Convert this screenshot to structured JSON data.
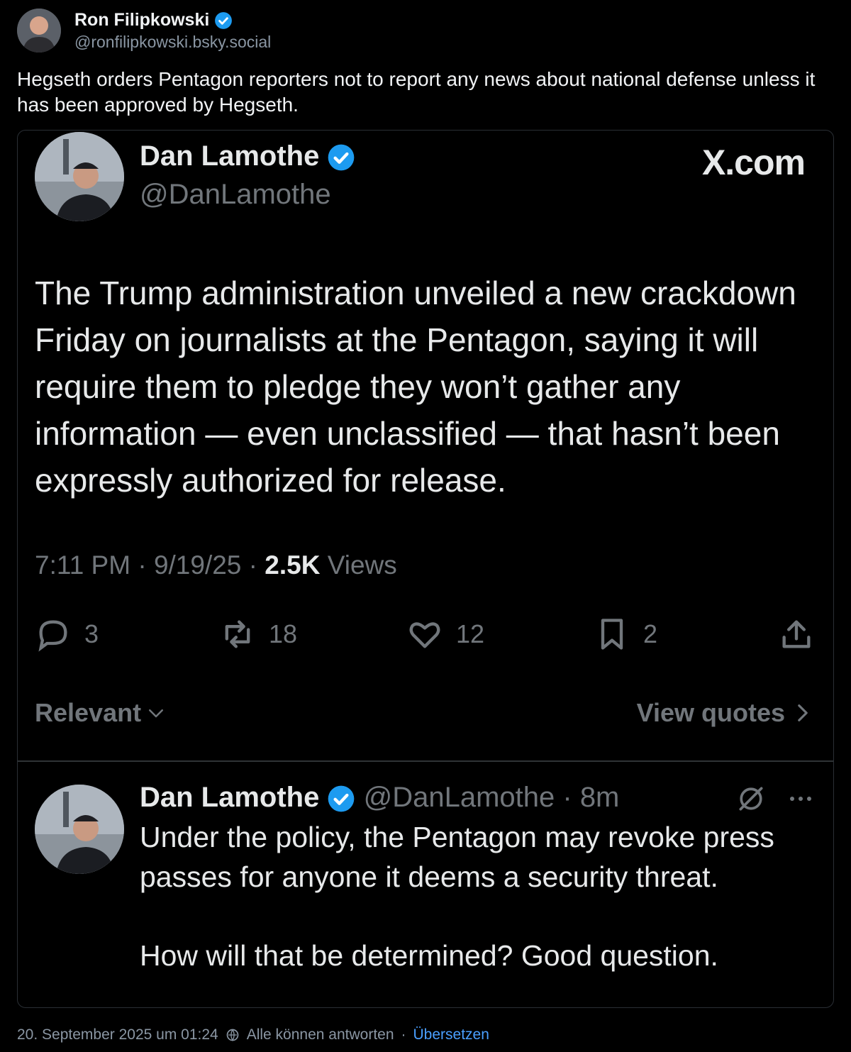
{
  "post": {
    "author": {
      "name": "Ron Filipkowski",
      "handle": "@ronfilipkowski.bsky.social"
    },
    "text": "Hegseth orders Pentagon reporters not to report any news about national defense unless it has been approved by Hegseth.",
    "verified_color": "#1d9bf0"
  },
  "embed": {
    "author": {
      "name": "Dan Lamothe",
      "handle": "@DanLamothe"
    },
    "source": "X.com",
    "text": "The Trump administration unveiled a new crackdown Friday on journalists at the Pentagon, saying it will require them to pledge they won’t gather any information — even unclassified — that hasn’t been expressly authorized for release.",
    "time": "7:11 PM",
    "date": "9/19/25",
    "views_count": "2.5K",
    "views_label": "Views",
    "actions": {
      "replies": "3",
      "reposts": "18",
      "likes": "12",
      "bookmarks": "2"
    },
    "sort_label": "Relevant",
    "view_quotes_label": "View quotes",
    "reply": {
      "name": "Dan Lamothe",
      "handle": "@DanLamothe",
      "age": "8m",
      "text_1": "Under the policy, the Pentagon may revoke press passes for anyone it deems a security threat.",
      "text_2": "How will that be determined? Good question."
    }
  },
  "footer": {
    "timestamp": "20. September 2025 um 01:24",
    "reply_setting": "Alle können antworten",
    "separator": "·",
    "translate": "Übersetzen"
  },
  "colors": {
    "accent": "#1d9bf0",
    "link": "#4a9fff",
    "muted": "#71767b"
  }
}
